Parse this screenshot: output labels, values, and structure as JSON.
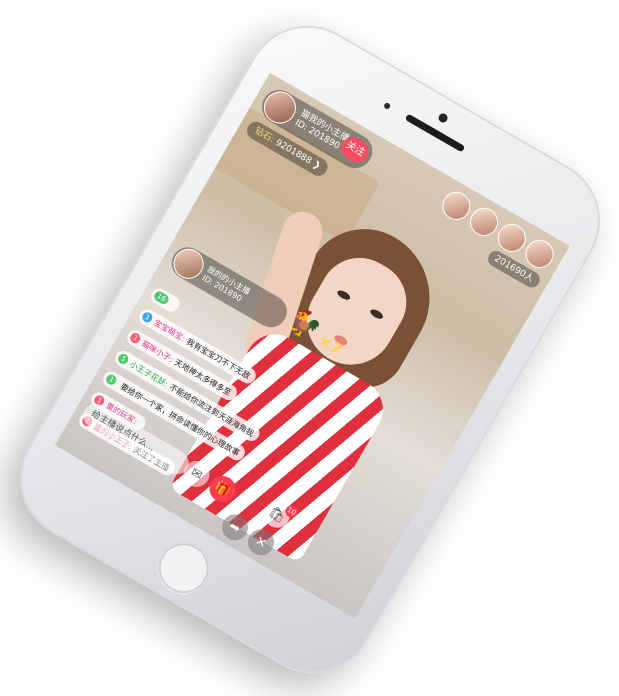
{
  "host": {
    "name": "猫我的小主播",
    "id_label": "ID:",
    "id_value": "201890",
    "follow_label": "关注"
  },
  "coins": {
    "label": "钻石:",
    "value": "9201888",
    "arrow": "❯"
  },
  "viewer_count": "201690人",
  "gift_banner": {
    "name": "我的的小主播",
    "id_label": "ID:",
    "id_value": "201890",
    "gift_icon": "rooster-icon",
    "combo": "×7"
  },
  "chat": [
    {
      "level": "16",
      "user": "",
      "text": "",
      "color": "#4ec86a",
      "name_color": "#2d7bd6"
    },
    {
      "level": "1",
      "user": "宝宝萌宝:",
      "text": "我有宝宝刀不下无敌",
      "color": "#36a7f0",
      "name_color": "#e0398e"
    },
    {
      "level": "1",
      "user": "猫咪小子:",
      "text": "天地神太多得多至",
      "color": "#ff5b7b",
      "name_color": "#e0398e"
    },
    {
      "level": "1",
      "user": "小王子花妖:",
      "text": "不能给你流注到天涯海角我",
      "color": "#4ec86a",
      "name_color": "#2aa84b"
    },
    {
      "level": "1",
      "user": "",
      "text": "要给你一个家，拼命读懂你的心理故事",
      "color": "#4ec86a",
      "name_color": "#2d7bd6"
    },
    {
      "level": "1",
      "user": "重的玩家:",
      "text": "",
      "color": "#ff5b7b",
      "name_color": "#e0398e"
    },
    {
      "level": "1",
      "user": "重的小王子:",
      "text": "关注了主播",
      "color": "#ff5b7b",
      "name_color": "#e0398e"
    }
  ],
  "input_placeholder": "给主播说点什么...",
  "actions": {
    "message_icon": "message-icon",
    "gift_icon": "gift-icon",
    "share_icon": "share-icon",
    "close_icon": "close-icon",
    "shop_icon": "shopping-bag-icon",
    "shop_badge": "10"
  },
  "colors": {
    "accent": "#ff4a63",
    "gold": "#ffd34d"
  }
}
